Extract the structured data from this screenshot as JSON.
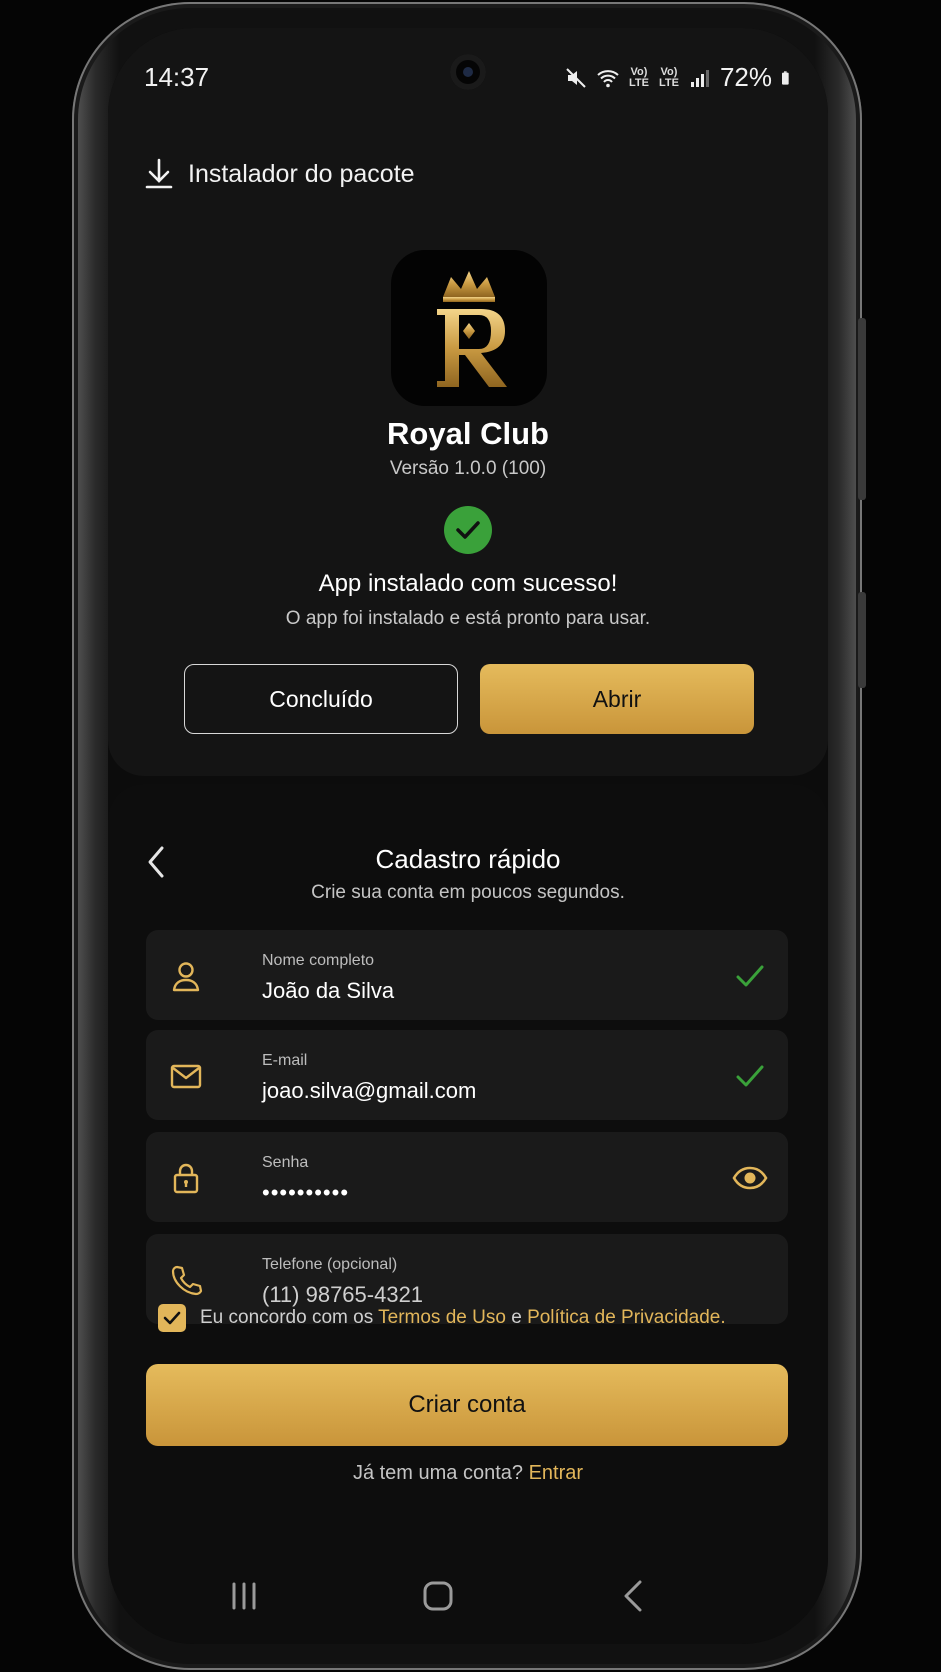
{
  "status_bar": {
    "time": "14:37",
    "battery": "72%",
    "lte_1": "Vo) LTE",
    "lte_2": "Vo) LTE"
  },
  "installer": {
    "title": "Instalador do pacote",
    "app_name": "Royal Club",
    "version": "Versão 1.0.0 (100)",
    "success_title": "App instalado com sucesso!",
    "success_subtitle": "O app foi instalado e está pronto para usar.",
    "done_label": "Concluído",
    "open_label": "Abrir"
  },
  "register": {
    "title": "Cadastro rápido",
    "subtitle": "Crie sua conta em poucos segundos.",
    "fields": [
      {
        "label": "Nome completo",
        "value": "João da Silva"
      },
      {
        "label": "E-mail",
        "value": "joao.silva@gmail.com"
      },
      {
        "label": "Senha",
        "value": "••••••••••"
      },
      {
        "label": "Telefone (opcional)",
        "value": "(11) 98765-4321"
      }
    ],
    "agree_prefix": "Eu concordo com os",
    "terms_link": "Termos de Uso",
    "agree_and": "e",
    "privacy_link": "Política de Privacidade",
    "agree_suffix": ".",
    "create_label": "Criar conta",
    "login_prompt": "Já tem uma conta?",
    "login_link": "Entrar"
  },
  "colors": {
    "accent_gold": "#e2b65a",
    "success_green": "#3aa13a",
    "background": "#0c0c0c"
  },
  "icons": [
    "download-icon",
    "check-circle-icon",
    "chevron-left-icon",
    "user-icon",
    "mail-icon",
    "lock-icon",
    "phone-icon",
    "eye-icon",
    "checkmark-icon",
    "recent-apps-icon",
    "home-icon",
    "back-icon"
  ]
}
